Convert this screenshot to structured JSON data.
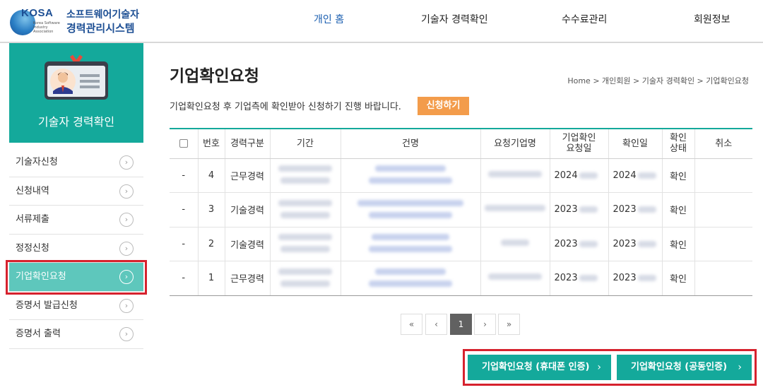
{
  "header": {
    "logo_kosa": "KOSA",
    "logo_sub": "Korea Software Industry Association",
    "logo_line1": "소프트웨어기술자",
    "logo_line2": "경력관리시스템",
    "nav": [
      "개인 홈",
      "기술자 경력확인",
      "수수료관리",
      "회원정보"
    ]
  },
  "sidebar": {
    "hero_title": "기술자 경력확인",
    "items": [
      {
        "label": "기술자신청"
      },
      {
        "label": "신청내역"
      },
      {
        "label": "서류제출"
      },
      {
        "label": "정정신청"
      },
      {
        "label": "기업확인요청",
        "active": true
      },
      {
        "label": "증명서 발급신청"
      },
      {
        "label": "증명서 출력"
      }
    ],
    "arrow_icon": "circle-chevron-right-icon"
  },
  "main": {
    "title": "기업확인요청",
    "breadcrumb": "Home > 개인회원 > 기술자 경력확인 > 기업확인요청",
    "description": "기업확인요청 후 기업측에 확인받아 신청하기 진행 바랍니다.",
    "apply_button": "신청하기"
  },
  "table": {
    "headers": [
      "",
      "번호",
      "경력구분",
      "기간",
      "건명",
      "요청기업명",
      "기업확인 요청일",
      "확인일",
      "확인 상태",
      "취소"
    ],
    "rows": [
      {
        "check": "-",
        "no": "4",
        "type": "근무경력",
        "req_date": "2024",
        "conf_date": "2024",
        "status": "확인"
      },
      {
        "check": "-",
        "no": "3",
        "type": "기술경력",
        "req_date": "2023",
        "conf_date": "2023",
        "status": "확인"
      },
      {
        "check": "-",
        "no": "2",
        "type": "기술경력",
        "req_date": "2023",
        "conf_date": "2023",
        "status": "확인"
      },
      {
        "check": "-",
        "no": "1",
        "type": "근무경력",
        "req_date": "2023",
        "conf_date": "2023",
        "status": "확인"
      }
    ]
  },
  "pagination": {
    "first": "«",
    "prev": "‹",
    "current": "1",
    "next": "›",
    "last": "»"
  },
  "actions": {
    "phone_auth": "기업확인요청 (휴대폰 인증)",
    "cert_auth": "기업확인요청 (공동인증)",
    "chevron": "›"
  },
  "colors": {
    "teal": "#14a99b",
    "active_menu": "#5ec7bc",
    "orange": "#f39c4b",
    "highlight_red": "#d6222e",
    "nav_active": "#1b5fb0"
  }
}
